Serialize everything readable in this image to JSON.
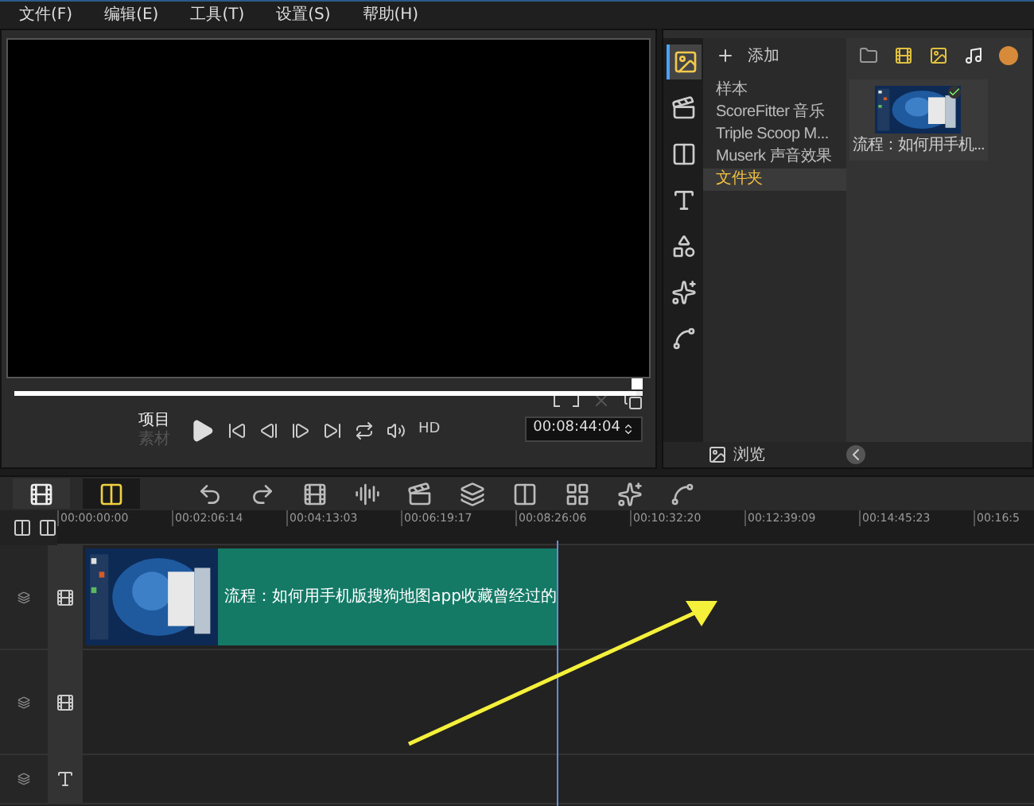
{
  "menu": [
    {
      "label": "文件(F)"
    },
    {
      "label": "编辑(E)"
    },
    {
      "label": "工具(T)"
    },
    {
      "label": "设置(S)"
    },
    {
      "label": "帮助(H)"
    }
  ],
  "preview": {
    "modes": [
      {
        "label": "项目",
        "selected": true
      },
      {
        "label": "素材",
        "selected": false
      }
    ],
    "timecode": "00:08:44:04",
    "hd": "HD",
    "level": 0.99
  },
  "library": {
    "side_tabs": [
      {
        "kind": "media",
        "selected": true
      },
      {
        "kind": "instant",
        "selected": false
      },
      {
        "kind": "transition",
        "selected": false
      },
      {
        "kind": "title",
        "selected": false
      },
      {
        "kind": "graphic",
        "selected": false
      },
      {
        "kind": "filter",
        "selected": false
      },
      {
        "kind": "path",
        "selected": false
      }
    ],
    "add": "添加",
    "items": [
      {
        "label": "样本",
        "selected": false
      },
      {
        "label": "ScoreFitter 音乐",
        "selected": false
      },
      {
        "label": "Triple Scoop M...",
        "selected": false
      },
      {
        "label": "Muserk 声音效果",
        "selected": false
      },
      {
        "label": "文件夹",
        "selected": true
      }
    ],
    "thumbnails": [
      {
        "caption": "流程：如何用手机...",
        "checked": true
      }
    ],
    "browse": "浏览"
  },
  "timeline": {
    "view_modes": [
      {
        "kind": "storyboard",
        "selected": false
      },
      {
        "kind": "timeline",
        "selected": true
      }
    ],
    "ticks": [
      "00:00:00:00",
      "00:02:06:14",
      "00:04:13:03",
      "00:06:19:17",
      "00:08:26:06",
      "00:10:32:20",
      "00:12:39:09",
      "00:14:45:23",
      "00:16:5"
    ],
    "tracks": [
      {
        "kind": "video",
        "clip": {
          "caption": "流程：如何用手机版搜狗地图app收藏曾经过的"
        }
      },
      {
        "kind": "overlay"
      },
      {
        "kind": "title"
      }
    ]
  }
}
